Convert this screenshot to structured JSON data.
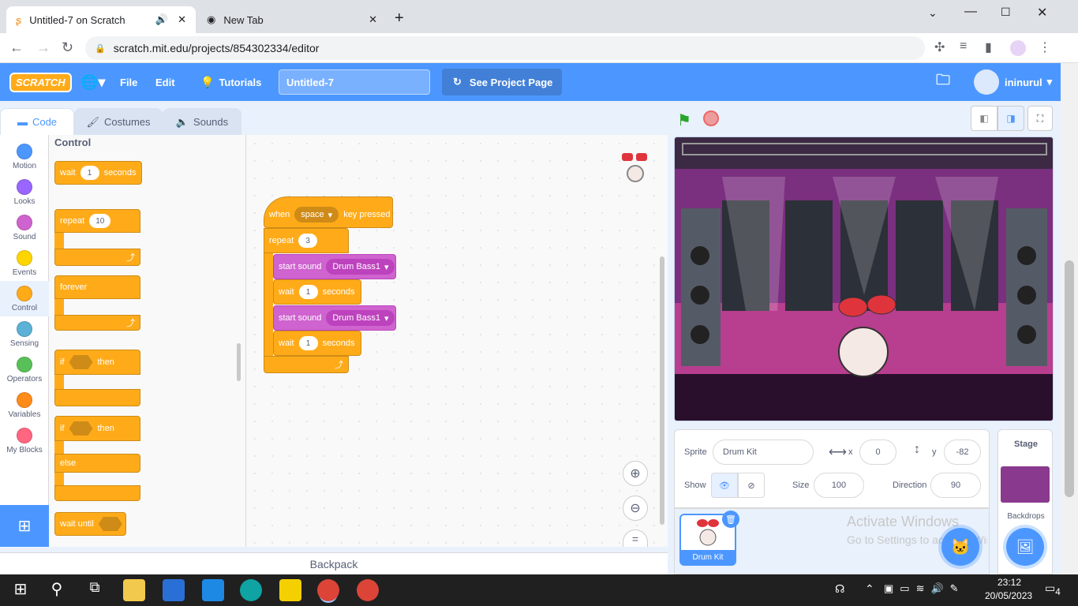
{
  "browser": {
    "tabs": [
      {
        "title": "Untitled-7 on Scratch"
      },
      {
        "title": "New Tab"
      }
    ],
    "url": "scratch.mit.edu/projects/854302334/editor"
  },
  "menu": {
    "logo": "SCRATCH",
    "file": "File",
    "edit": "Edit",
    "tutorials": "Tutorials",
    "project_title": "Untitled-7",
    "see_project": "See Project Page",
    "username": "ininurul"
  },
  "editor_tabs": {
    "code": "Code",
    "costumes": "Costumes",
    "sounds": "Sounds"
  },
  "categories": [
    {
      "label": "Motion",
      "color": "#4c97ff"
    },
    {
      "label": "Looks",
      "color": "#9966ff"
    },
    {
      "label": "Sound",
      "color": "#cf63cf"
    },
    {
      "label": "Events",
      "color": "#ffd500"
    },
    {
      "label": "Control",
      "color": "#ffab19"
    },
    {
      "label": "Sensing",
      "color": "#5cb1d6"
    },
    {
      "label": "Operators",
      "color": "#59c059"
    },
    {
      "label": "Variables",
      "color": "#ff8c1a"
    },
    {
      "label": "My Blocks",
      "color": "#ff6680"
    }
  ],
  "palette": {
    "heading": "Control",
    "wait": "wait",
    "wait_value": "1",
    "seconds": "seconds",
    "repeat": "repeat",
    "repeat_value": "10",
    "forever": "forever",
    "if": "if",
    "then": "then",
    "else": "else",
    "wait_until": "wait until"
  },
  "script": {
    "when": "when",
    "key": "space",
    "key_pressed": "key pressed",
    "repeat": "repeat",
    "repeat_value": "3",
    "start_sound": "start sound",
    "sound1": "Drum Bass1",
    "wait": "wait",
    "wait1": "1",
    "seconds": "seconds",
    "sound2": "Drum Bass1",
    "wait2": "1"
  },
  "backpack": "Backpack",
  "sprite_info": {
    "sprite_label": "Sprite",
    "sprite_name": "Drum Kit",
    "x_label": "x",
    "x": "0",
    "y_label": "y",
    "y": "-82",
    "show_label": "Show",
    "size_label": "Size",
    "size": "100",
    "direction_label": "Direction",
    "direction": "90"
  },
  "sprite_list": [
    {
      "name": "Drum Kit"
    }
  ],
  "stage_panel": {
    "title": "Stage",
    "backdrops": "Backdrops"
  },
  "watermark": {
    "line1": "Activate Windows",
    "line2": "Go to Settings to activate Windows."
  },
  "taskbar": {
    "time": "23:12",
    "date": "20/05/2023",
    "notifications": "4"
  }
}
